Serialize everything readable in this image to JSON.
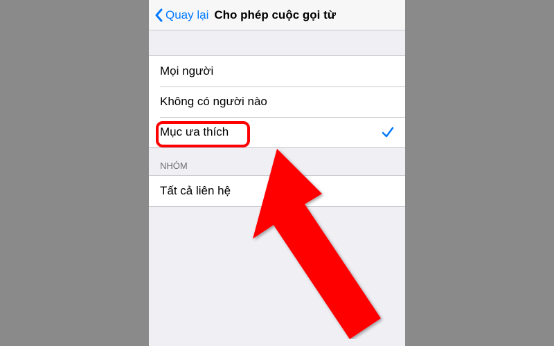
{
  "navbar": {
    "back_label": "Quay lại",
    "title": "Cho phép cuộc gọi từ"
  },
  "group1": {
    "items": [
      {
        "label": "Mọi người",
        "selected": false
      },
      {
        "label": "Không có người nào",
        "selected": false
      },
      {
        "label": "Mục ưa thích",
        "selected": true
      }
    ]
  },
  "group2": {
    "header": "Nhóm",
    "items": [
      {
        "label": "Tất cả liên hệ",
        "selected": false
      }
    ]
  },
  "annotation": {
    "highlight_target": "favorites",
    "arrow_color": "#ff0000"
  }
}
